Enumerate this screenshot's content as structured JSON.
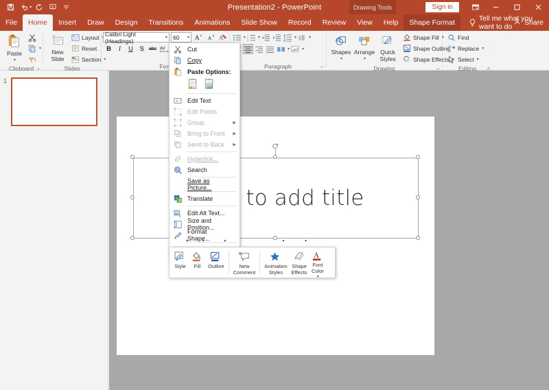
{
  "window": {
    "title": "Presentation2  -  PowerPoint",
    "contextual_tab_label": "Drawing Tools",
    "sign_in": "Sign in",
    "minimize": "minimize-icon",
    "maximize": "maximize-icon",
    "close": "close-icon",
    "ribbon_display_options": "ribbon-display-options-icon"
  },
  "qat": {
    "items": [
      {
        "name": "save-icon",
        "label": "Save"
      },
      {
        "name": "undo-icon",
        "label": "Undo"
      },
      {
        "name": "redo-icon",
        "label": "Redo"
      },
      {
        "name": "start-from-beginning-icon",
        "label": "Start From Beginning"
      },
      {
        "name": "customize-qat-icon",
        "label": "Customize Quick Access Toolbar"
      }
    ]
  },
  "tabs": {
    "items": [
      {
        "label": "File",
        "active": false
      },
      {
        "label": "Home",
        "active": true
      },
      {
        "label": "Insert",
        "active": false
      },
      {
        "label": "Draw",
        "active": false
      },
      {
        "label": "Design",
        "active": false
      },
      {
        "label": "Transitions",
        "active": false
      },
      {
        "label": "Animations",
        "active": false
      },
      {
        "label": "Slide Show",
        "active": false
      },
      {
        "label": "Record",
        "active": false
      },
      {
        "label": "Review",
        "active": false
      },
      {
        "label": "View",
        "active": false
      },
      {
        "label": "Help",
        "active": false
      }
    ],
    "contextual": "Shape Format",
    "tell_me": "Tell me what you want to do",
    "share": "Share"
  },
  "ribbon": {
    "groups": [
      {
        "title": "Clipboard",
        "paste": "Paste",
        "cut": "Cut",
        "copy": "Copy",
        "format_painter": "Format Painter"
      },
      {
        "title": "Slides",
        "new_slide": "New\nSlide",
        "new_slide_l1": "New",
        "new_slide_l2": "Slide",
        "layout": "Layout",
        "reset": "Reset",
        "section": "Section"
      },
      {
        "title": "Font",
        "font_name": "Calibri Light (Headings)",
        "font_size": "60",
        "increase_font": "A",
        "decrease_font": "A",
        "clear_formatting": "Clear All Formatting",
        "bold": "B",
        "italic": "I",
        "underline": "U",
        "strikethrough": "S",
        "shadow": "abc",
        "character_spacing": "AV"
      },
      {
        "title": "Paragraph"
      },
      {
        "title": "Drawing",
        "shapes": "Shapes",
        "arrange": "Arrange",
        "quick_styles_l1": "Quick",
        "quick_styles_l2": "Styles",
        "shape_fill": "Shape Fill",
        "shape_outline": "Shape Outline",
        "shape_effects": "Shape Effects"
      },
      {
        "title": "Editing",
        "find": "Find",
        "replace": "Replace",
        "select": "Select"
      }
    ]
  },
  "slide_pane": {
    "slides": [
      {
        "number": "1"
      }
    ]
  },
  "slide": {
    "title_placeholder": "Click to add title"
  },
  "context_menu": {
    "items": [
      {
        "label": "Cut",
        "icon": "scissors-icon",
        "disabled": false,
        "submenu": false,
        "accel": "t"
      },
      {
        "label": "Copy",
        "icon": "copy-icon",
        "disabled": false,
        "submenu": false,
        "accel": "C"
      },
      {
        "label": "Paste Options:",
        "icon": "paste-icon",
        "disabled": false,
        "submenu": false,
        "header": true
      },
      {
        "label": "Edit Text",
        "icon": "edit-text-icon",
        "disabled": false,
        "submenu": false,
        "accel": "x"
      },
      {
        "label": "Edit Points",
        "icon": "edit-points-icon",
        "disabled": true,
        "submenu": false
      },
      {
        "label": "Group",
        "icon": "group-icon",
        "disabled": true,
        "submenu": true
      },
      {
        "label": "Bring to Front",
        "icon": "bring-to-front-icon",
        "disabled": true,
        "submenu": true
      },
      {
        "label": "Send to Back",
        "icon": "send-to-back-icon",
        "disabled": true,
        "submenu": true
      },
      {
        "label": "Hyperlink...",
        "icon": "hyperlink-icon",
        "disabled": true,
        "submenu": false
      },
      {
        "label": "Search",
        "icon": "search-icon",
        "disabled": false,
        "submenu": false
      },
      {
        "label": "Save as Picture...",
        "icon": "none",
        "disabled": false,
        "submenu": false
      },
      {
        "label": "Translate",
        "icon": "translate-icon",
        "disabled": false,
        "submenu": false
      },
      {
        "label": "Edit Alt Text...",
        "icon": "alt-text-icon",
        "disabled": false,
        "submenu": false
      },
      {
        "label": "Size and Position...",
        "icon": "size-position-icon",
        "disabled": false,
        "submenu": false
      },
      {
        "label": "Format Shape...",
        "icon": "format-shape-icon",
        "disabled": false,
        "submenu": false
      },
      {
        "label": "New Comment",
        "icon": "comment-icon",
        "disabled": false,
        "submenu": false
      }
    ],
    "paste_options": [
      {
        "name": "paste-use-destination-theme-icon"
      },
      {
        "name": "paste-picture-icon"
      }
    ]
  },
  "mini_toolbar": {
    "items": [
      {
        "l1": "Style",
        "l2": "",
        "icon": "shape-style-icon",
        "caret": true
      },
      {
        "l1": "Fill",
        "l2": "",
        "icon": "fill-bucket-icon",
        "caret": true
      },
      {
        "l1": "Outline",
        "l2": "",
        "icon": "outline-pen-icon",
        "caret": true
      },
      {
        "l1": "New",
        "l2": "Comment",
        "icon": "new-comment-icon",
        "caret": false
      },
      {
        "l1": "Animation",
        "l2": "Styles",
        "icon": "animation-star-icon",
        "caret": true
      },
      {
        "l1": "Shape",
        "l2": "Effects",
        "icon": "shape-effects-icon",
        "caret": true
      },
      {
        "l1": "Font",
        "l2": "Color",
        "icon": "font-color-icon",
        "caret": true
      }
    ]
  },
  "colors": {
    "accent": "#b7472a",
    "accent_dark": "#a03f25",
    "ribbon_bg": "#f3f3f3",
    "editor_bg": "#a8a8a8",
    "slide_bg": "#ffffff",
    "thumb_border": "#c0502e",
    "office_blue": "#2b579a"
  }
}
